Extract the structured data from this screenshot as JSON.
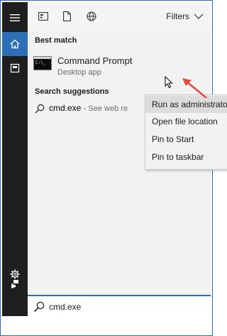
{
  "toolbar": {
    "filters_label": "Filters"
  },
  "best_match": {
    "heading": "Best match",
    "app_name": "Command Prompt",
    "app_type": "Desktop app",
    "icon_text": "C:\\_"
  },
  "suggestions": {
    "heading": "Search suggestions",
    "query": "cmd.exe",
    "hint": "- See web re"
  },
  "context_menu": {
    "items": [
      "Run as administrator",
      "Open file location",
      "Pin to Start",
      "Pin to taskbar"
    ],
    "hovered_index": 0
  },
  "search": {
    "value": "cmd.exe"
  },
  "colors": {
    "accent": "#2d6fb7",
    "rail": "#1f1f1f",
    "arrow": "#e04a3f"
  }
}
